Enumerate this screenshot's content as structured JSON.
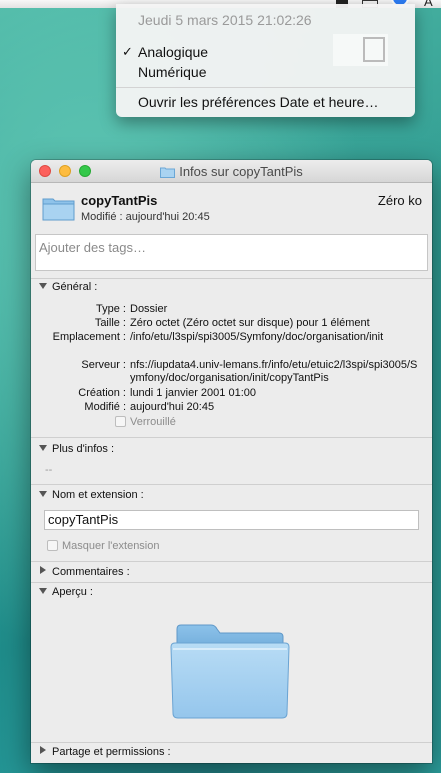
{
  "menu": {
    "date": "Jeudi 5 mars 2015 21:02:26",
    "items": [
      "Analogique",
      "Numérique"
    ],
    "checked": "✓",
    "prefs": "Ouvrir les préférences Date et heure…"
  },
  "menubar": {
    "trailing_text": "A"
  },
  "window": {
    "title": "Infos sur copyTantPis",
    "name": "copyTantPis",
    "modified": "Modifié : aujourd'hui 20:45",
    "size": "Zéro ko",
    "tags_placeholder": "Ajouter des tags…"
  },
  "general": {
    "header": "Général :",
    "rows": [
      {
        "k": "Type :",
        "v": "Dossier"
      },
      {
        "k": "Taille :",
        "v": "Zéro octet (Zéro octet sur disque) pour 1 élément"
      },
      {
        "k": "Emplacement :",
        "v": "/info/etu/l3spi/spi3005/Symfony/doc/organisation/init"
      },
      {
        "k": "Serveur :",
        "v": "nfs://iupdata4.univ-lemans.fr/info/etu/etuic2/l3spi/spi3005/Symfony/doc/organisation/init/copyTantPis"
      },
      {
        "k": "Création :",
        "v": "lundi 1 janvier 2001 01:00"
      },
      {
        "k": "Modifié :",
        "v": "aujourd'hui 20:45"
      }
    ],
    "locked": "Verrouillé"
  },
  "more": {
    "header": "Plus d'infos :",
    "value": "--"
  },
  "name_ext": {
    "header": "Nom et extension :",
    "value": "copyTantPis",
    "hide_ext": "Masquer l'extension"
  },
  "comments": {
    "header": "Commentaires :"
  },
  "preview": {
    "header": "Aperçu :"
  },
  "sharing": {
    "header": "Partage et permissions :"
  },
  "colors": {
    "folder_light": "#a9d3f1",
    "folder_dark": "#6aa7d6",
    "accent": "#2d7df6"
  }
}
